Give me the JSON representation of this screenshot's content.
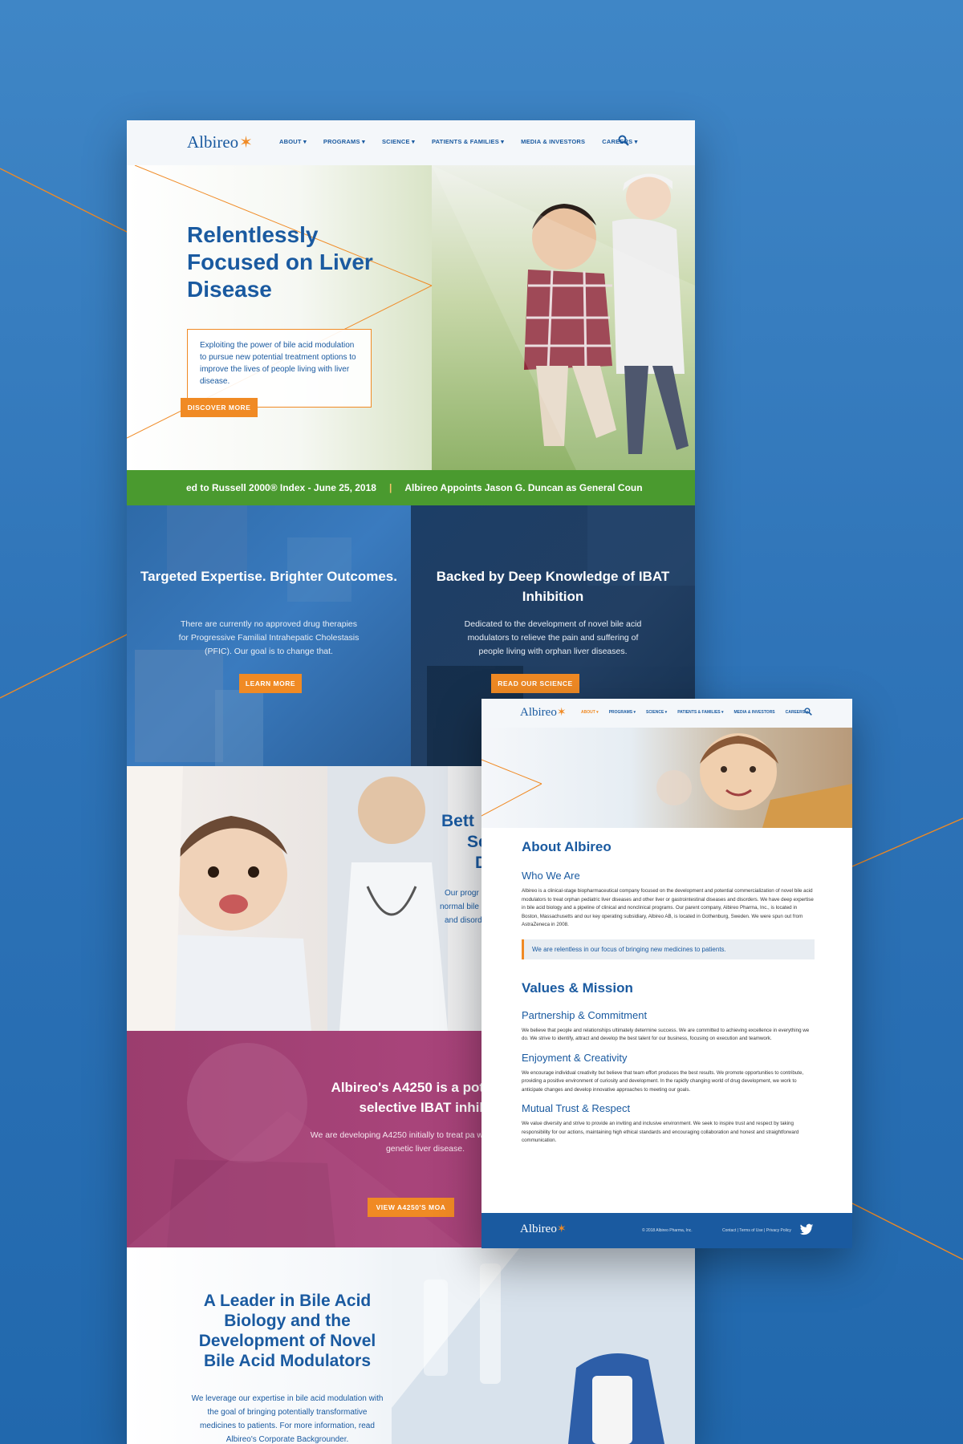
{
  "brand": {
    "name": "Albireo",
    "orange": "#f08a24",
    "blue": "#1a5aa0",
    "green": "#4a9a2f"
  },
  "nav": {
    "items": [
      "ABOUT ▾",
      "PROGRAMS ▾",
      "SCIENCE ▾",
      "PATIENTS & FAMILIES ▾",
      "MEDIA & INVESTORS",
      "CAREERS ▾"
    ],
    "search_icon": "search-icon"
  },
  "hero": {
    "title": "Relentlessly Focused on Liver Disease",
    "body": "Exploiting the power of bile acid modulation to pursue new potential treatment options to improve the lives of people living with liver disease.",
    "button": "DISCOVER MORE"
  },
  "ticker": {
    "item1": "ed to Russell 2000® Index - June 25, 2018",
    "separator": "|",
    "item2": "Albireo Appoints Jason G. Duncan as General Coun"
  },
  "panels": [
    {
      "title": "Targeted Expertise. Brighter Outcomes.",
      "body": "There are currently no approved drug therapies for Progressive Familial Intrahepatic Cholestasis (PFIC). Our goal is to change that.",
      "button": "LEARN MORE"
    },
    {
      "title": "Backed by Deep Knowledge of IBAT Inhibition",
      "body": "Dedicated to the development of novel bile acid modulators to relieve the pain and suffering of people living with orphan liver diseases.",
      "button": "READ OUR SCIENCE"
    }
  ],
  "baby_section": {
    "title_l1": "Bett",
    "title_l2": "Sc",
    "title_l3": "D",
    "body_l1": "Our progr",
    "body_l2": "normal bile",
    "body_l3": "and disord"
  },
  "a4250": {
    "title": "Albireo's A4250 is a pote and selective IBAT inhibi",
    "body": "We are developing A4250 initially to treat pa with PFIC, a rare genetic liver disease.",
    "button": "VIEW A4250'S MOA"
  },
  "leader": {
    "title": "A Leader in Bile Acid Biology and the Development of Novel Bile Acid Modulators",
    "body": "We leverage our expertise in bile acid modulation with the goal of bringing potentially transformative medicines to patients. For more information, read Albireo's Corporate Backgrounder."
  },
  "about_page": {
    "nav_items": [
      "ABOUT ▾",
      "PROGRAMS ▾",
      "SCIENCE ▾",
      "PATIENTS & FAMILIES ▾",
      "MEDIA & INVESTORS",
      "CAREERS ▾"
    ],
    "title": "About Albireo",
    "who_heading": "Who We Are",
    "who_body": "Albireo is a clinical-stage biopharmaceutical company focused on the development and potential commercialization of novel bile acid modulators to treat orphan pediatric liver diseases and other liver or gastrointestinal diseases and disorders. We have deep expertise in bile acid biology and a pipeline of clinical and nonclinical programs. Our parent company, Albireo Pharma, Inc., is located in Boston, Massachusetts and our key operating subsidiary, Albireo AB, is located in Gothenburg, Sweden. We were spun out from AstraZeneca in 2008.",
    "quote": "We are relentless in our focus of bringing new medicines to patients.",
    "values_heading": "Values & Mission",
    "values": [
      {
        "heading": "Partnership & Commitment",
        "body": "We believe that people and relationships ultimately determine success. We are committed to achieving excellence in everything we do. We strive to identify, attract and develop the best talent for our business, focusing on execution and teamwork."
      },
      {
        "heading": "Enjoyment & Creativity",
        "body": "We encourage individual creativity but believe that team effort produces the best results. We promote opportunities to contribute, providing a positive environment of curiosity and development. In the rapidly changing world of drug development, we work to anticipate changes and develop innovative approaches to meeting our goals."
      },
      {
        "heading": "Mutual Trust & Respect",
        "body": "We value diversity and strive to provide an inviting and inclusive environment. We seek to inspire trust and respect by taking responsibility for our actions, maintaining high ethical standards and encouraging collaboration and honest and straightforward communication."
      }
    ],
    "footer_copy": "© 2018 Albireo Pharma, Inc.",
    "footer_links": "Contact | Terms of Use | Privacy Policy"
  }
}
